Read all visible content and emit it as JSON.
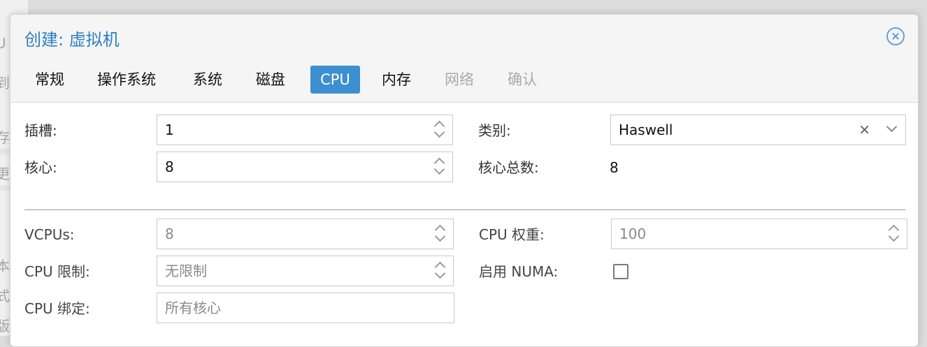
{
  "background": {
    "fragments": [
      "U",
      "到",
      "存",
      "更",
      "本",
      "式",
      "版"
    ]
  },
  "dialog": {
    "title": "创建: 虚拟机",
    "tabs": [
      {
        "label": "常规",
        "state": "normal"
      },
      {
        "label": "操作系统",
        "state": "normal"
      },
      {
        "label": "系统",
        "state": "normal"
      },
      {
        "label": "磁盘",
        "state": "normal"
      },
      {
        "label": "CPU",
        "state": "active"
      },
      {
        "label": "内存",
        "state": "normal"
      },
      {
        "label": "网络",
        "state": "disabled"
      },
      {
        "label": "确认",
        "state": "disabled"
      }
    ]
  },
  "form": {
    "sockets": {
      "label": "插槽:",
      "value": "1"
    },
    "cores": {
      "label": "核心:",
      "value": "8"
    },
    "type": {
      "label": "类别:",
      "value": "Haswell",
      "clear_icon": "✕"
    },
    "total_cores": {
      "label": "核心总数:",
      "value": "8"
    },
    "vcpus": {
      "label": "VCPUs:",
      "value": "8"
    },
    "cpu_limit": {
      "label": "CPU 限制:",
      "placeholder": "无限制"
    },
    "cpu_affinity": {
      "label": "CPU 绑定:",
      "placeholder": "所有核心"
    },
    "cpu_weight": {
      "label": "CPU 权重:",
      "value": "100"
    },
    "numa": {
      "label": "启用 NUMA:",
      "checked": false
    }
  },
  "colors": {
    "accent": "#3c8fd1",
    "title": "#2f7fc0"
  }
}
